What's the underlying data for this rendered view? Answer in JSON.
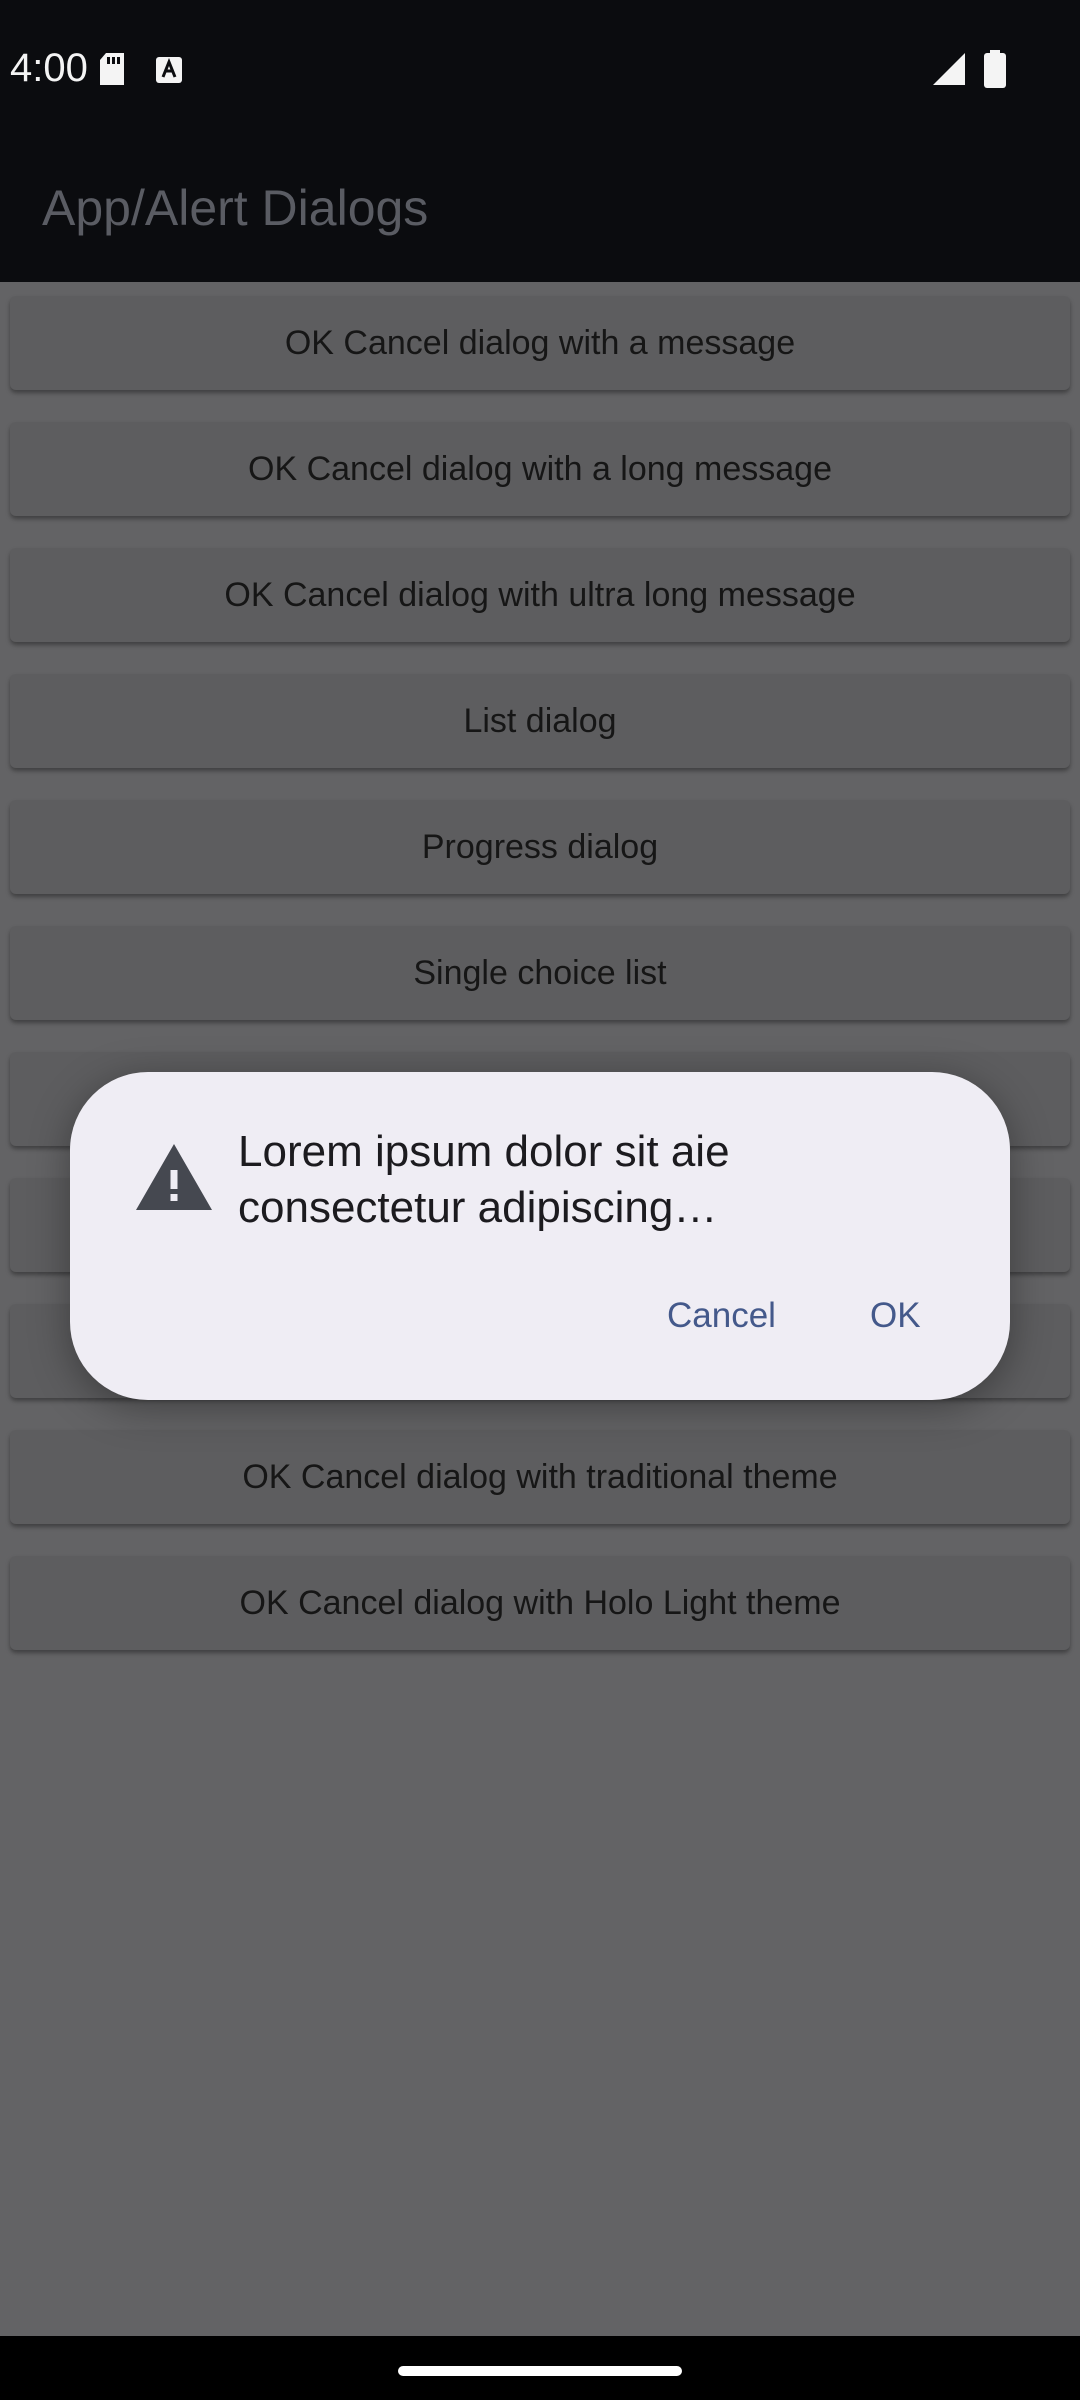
{
  "status_bar": {
    "time": "4:00",
    "icons": [
      "sd-card-icon",
      "a-keyboard-icon",
      "signal-icon",
      "battery-icon"
    ]
  },
  "app_bar": {
    "title": "App/Alert Dialogs"
  },
  "buttons": [
    "OK Cancel dialog with a message",
    "OK Cancel dialog with a long message",
    "OK Cancel dialog with ultra long message",
    "List dialog",
    "Progress dialog",
    "Single choice list",
    "",
    "",
    "",
    "OK Cancel dialog with traditional theme",
    "OK Cancel dialog with Holo Light theme"
  ],
  "dialog": {
    "icon": "warning-icon",
    "message": "Lorem ipsum dolor sit aie consectetur adipiscing…",
    "cancel_label": "Cancel",
    "ok_label": "OK"
  },
  "colors": {
    "scrim": "#636365",
    "dialog_bg": "#efedf4",
    "dialog_button_text": "#44598b",
    "app_bar": "#0b0c0f"
  }
}
